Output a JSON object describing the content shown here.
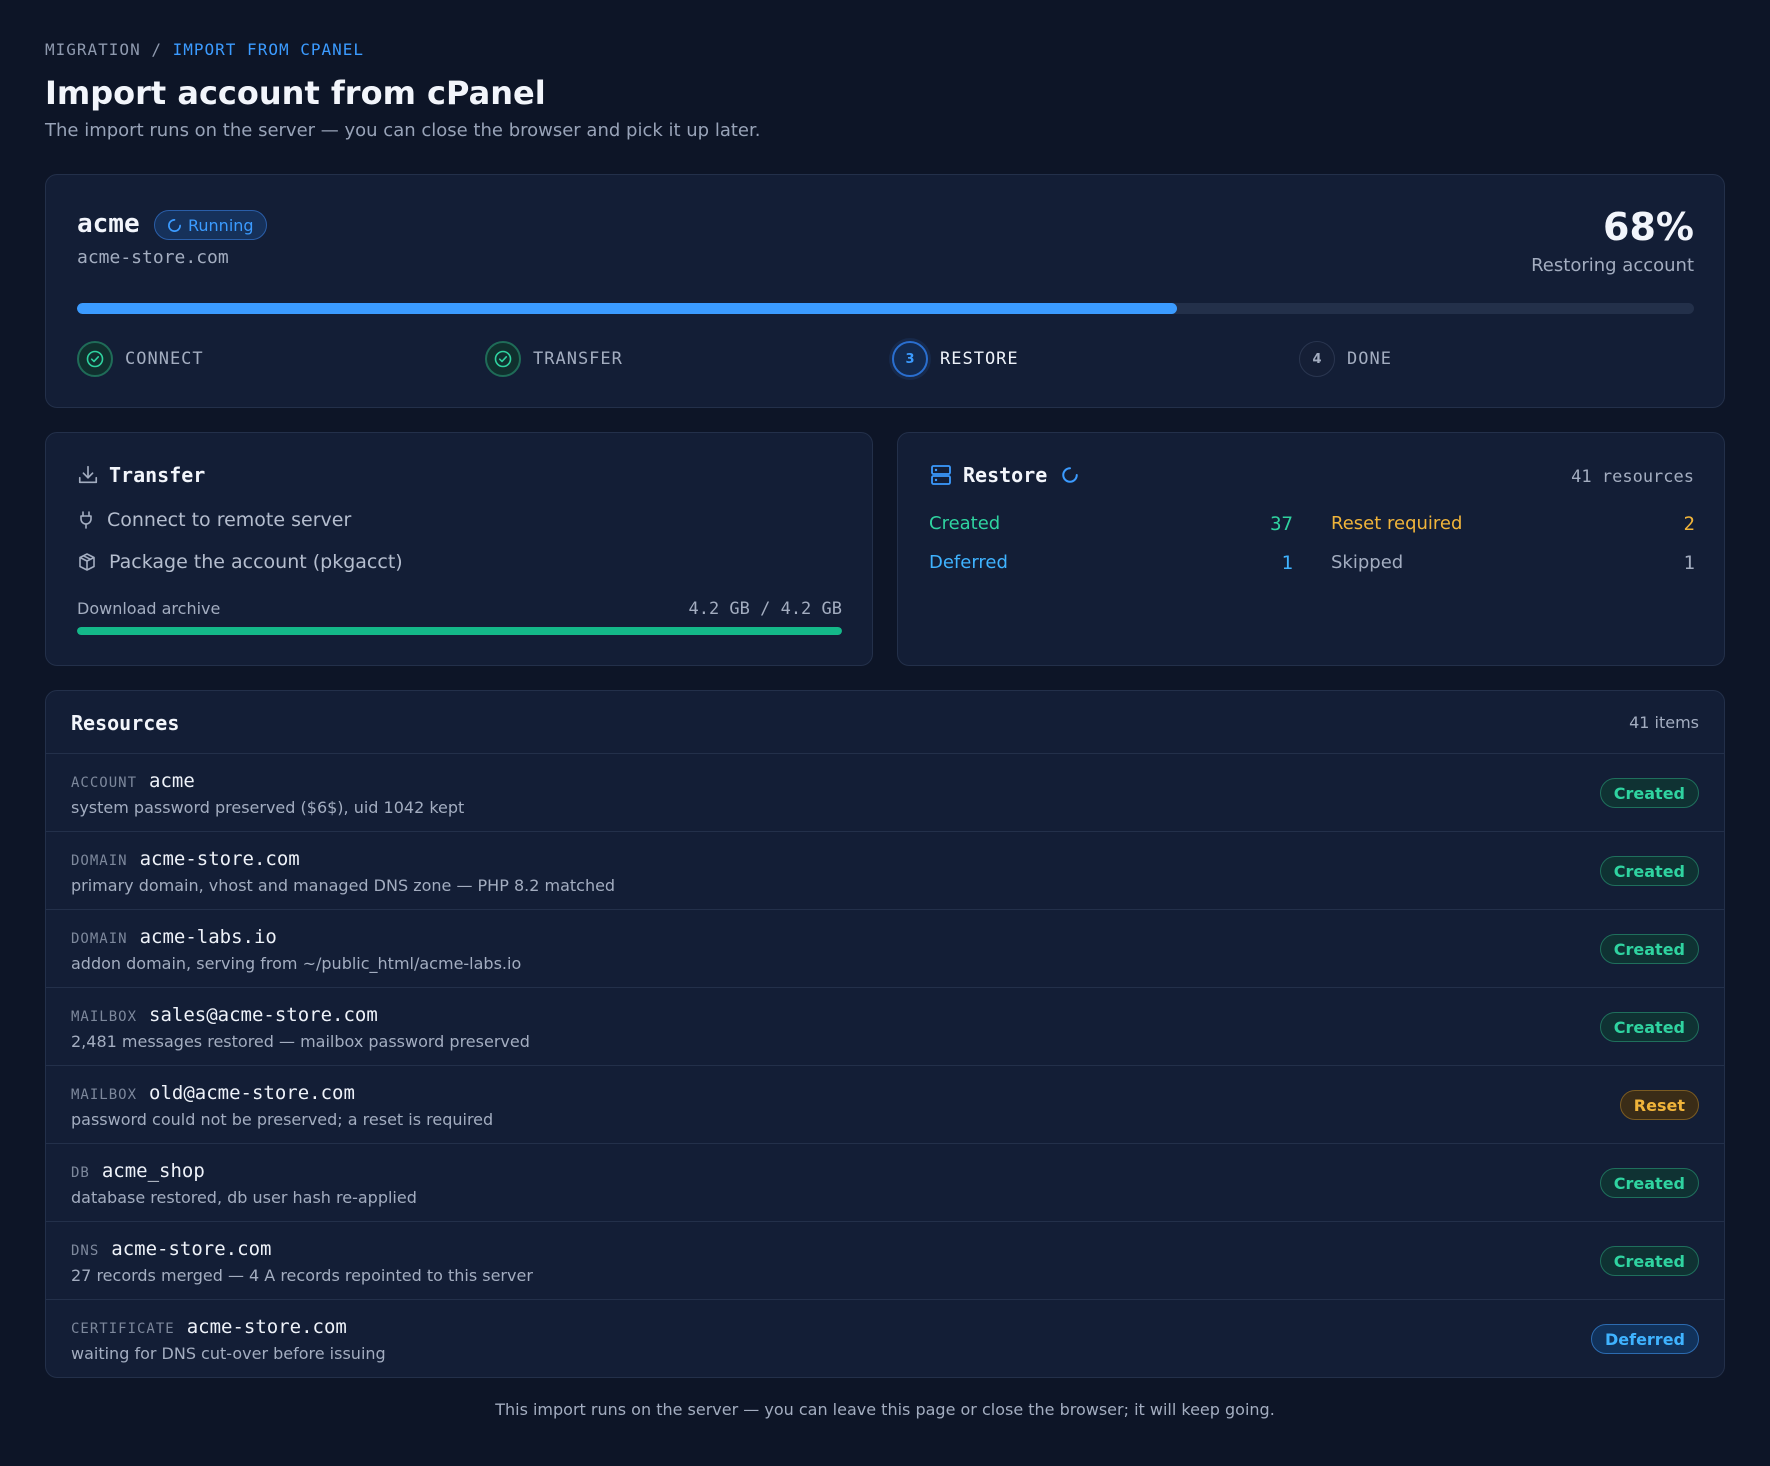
{
  "breadcrumb": {
    "parent": "MIGRATION",
    "separator": "/",
    "current": "IMPORT FROM CPANEL"
  },
  "header": {
    "title": "Import account from cPanel",
    "subtitle": "The import runs on the server — you can close the browser and pick it up later."
  },
  "account": {
    "name": "acme",
    "status": "Running",
    "domain": "acme-store.com",
    "percent_text": "68%",
    "progress": 0.68,
    "phase": "Restoring account"
  },
  "steps": [
    {
      "label": "CONNECT",
      "state": "done",
      "number": "1"
    },
    {
      "label": "TRANSFER",
      "state": "done",
      "number": "2"
    },
    {
      "label": "RESTORE",
      "state": "active",
      "number": "3"
    },
    {
      "label": "DONE",
      "state": "pending",
      "number": "4"
    }
  ],
  "transfer": {
    "title": "Transfer",
    "items": [
      {
        "label": "Connect to remote server",
        "icon": "plug-icon"
      },
      {
        "label": "Package the account (pkgacct)",
        "icon": "package-icon"
      }
    ],
    "download_label": "Download archive",
    "download_size": "4.2 GB / 4.2 GB",
    "download_progress": 1.0
  },
  "restore": {
    "title": "Restore",
    "count": "41 resources",
    "stats": [
      {
        "label": "Created",
        "value": "37",
        "color": "#2fd3a0"
      },
      {
        "label": "Reset required",
        "value": "2",
        "color": "#f0b43a"
      },
      {
        "label": "Deferred",
        "value": "1",
        "color": "#3fb3ff"
      },
      {
        "label": "Skipped",
        "value": "1",
        "color": "#a3adc0"
      }
    ]
  },
  "resources": {
    "title": "Resources",
    "count": "41 items",
    "rows": [
      {
        "kind": "ACCOUNT",
        "name": "acme",
        "desc": "system password preserved ($6$), uid 1042 kept",
        "status": "Created",
        "status_type": "created"
      },
      {
        "kind": "DOMAIN",
        "name": "acme-store.com",
        "desc": "primary domain, vhost and managed DNS zone — PHP 8.2 matched",
        "status": "Created",
        "status_type": "created"
      },
      {
        "kind": "DOMAIN",
        "name": "acme-labs.io",
        "desc": "addon domain, serving from ~/public_html/acme-labs.io",
        "status": "Created",
        "status_type": "created"
      },
      {
        "kind": "MAILBOX",
        "name": "sales@acme-store.com",
        "desc": "2,481 messages restored — mailbox password preserved",
        "status": "Created",
        "status_type": "created"
      },
      {
        "kind": "MAILBOX",
        "name": "old@acme-store.com",
        "desc": "password could not be preserved; a reset is required",
        "status": "Reset",
        "status_type": "reset"
      },
      {
        "kind": "DB",
        "name": "acme_shop",
        "desc": "database restored, db user hash re-applied",
        "status": "Created",
        "status_type": "created"
      },
      {
        "kind": "DNS",
        "name": "acme-store.com",
        "desc": "27 records merged — 4 A records repointed to this server",
        "status": "Created",
        "status_type": "created"
      },
      {
        "kind": "CERTIFICATE",
        "name": "acme-store.com",
        "desc": "waiting for DNS cut-over before issuing",
        "status": "Deferred",
        "status_type": "deferred"
      }
    ]
  },
  "footer": "This import runs on the server — you can leave this page or close the browser; it will keep going.",
  "colors": {
    "background": "#0d1527",
    "card": "#131e36",
    "accent": "#3b9bff",
    "success": "#14b889",
    "warning": "#f0b43a"
  }
}
